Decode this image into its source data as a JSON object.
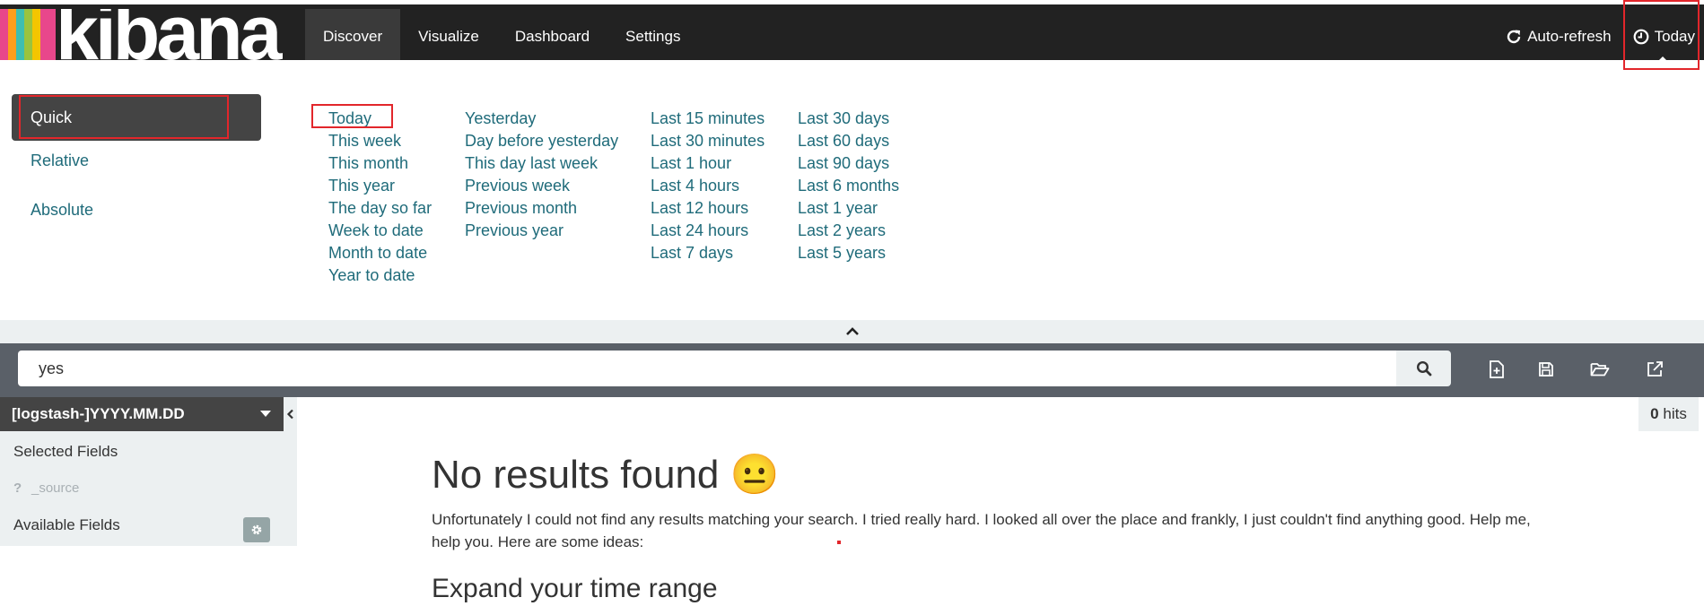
{
  "brand": {
    "name": "kibana",
    "stripe_colors": [
      "#e8478b",
      "#ff9e1b",
      "#3ebeb0",
      "#9ac33e",
      "#f4c500",
      "#009ad9",
      "#e8478b"
    ]
  },
  "nav": {
    "links": [
      {
        "label": "Discover",
        "active": true
      },
      {
        "label": "Visualize",
        "active": false
      },
      {
        "label": "Dashboard",
        "active": false
      },
      {
        "label": "Settings",
        "active": false
      }
    ],
    "auto_refresh": {
      "label": "Auto-refresh",
      "icon": "refresh-icon"
    },
    "time": {
      "label": "Today",
      "icon": "clock-icon"
    }
  },
  "timepicker": {
    "modes": [
      {
        "label": "Quick",
        "active": true
      },
      {
        "label": "Relative",
        "active": false
      },
      {
        "label": "Absolute",
        "active": false
      }
    ],
    "quick_columns": [
      [
        "Today",
        "This week",
        "This month",
        "This year",
        "The day so far",
        "Week to date",
        "Month to date",
        "Year to date"
      ],
      [
        "Yesterday",
        "Day before yesterday",
        "This day last week",
        "Previous week",
        "Previous month",
        "Previous year"
      ],
      [
        "Last 15 minutes",
        "Last 30 minutes",
        "Last 1 hour",
        "Last 4 hours",
        "Last 12 hours",
        "Last 24 hours",
        "Last 7 days"
      ],
      [
        "Last 30 days",
        "Last 60 days",
        "Last 90 days",
        "Last 6 months",
        "Last 1 year",
        "Last 2 years",
        "Last 5 years"
      ]
    ],
    "collapse_icon": "chevron-up-icon"
  },
  "search": {
    "query": "yes",
    "button_icon": "search-icon",
    "tools": [
      "new-document-icon",
      "save-icon",
      "open-folder-icon",
      "share-icon"
    ]
  },
  "sidebar": {
    "index_pattern": "[logstash-]YYYY.MM.DD",
    "selected_fields_heading": "Selected Fields",
    "selected_fields": [
      {
        "type": "?",
        "name": "_source"
      }
    ],
    "available_fields_heading": "Available Fields"
  },
  "results": {
    "hits_count": "0",
    "hits_label": "hits",
    "title": "No results found 😐",
    "message": "Unfortunately I could not find any results matching your search. I tried really hard. I looked all over the place and frankly, I just couldn't find anything good. Help me, help you. Here are some ideas:",
    "section_title": "Expand your time range"
  },
  "colors": {
    "navbar_bg": "#222222",
    "link": "#1f6b7a",
    "annotation": "#e2262b"
  }
}
